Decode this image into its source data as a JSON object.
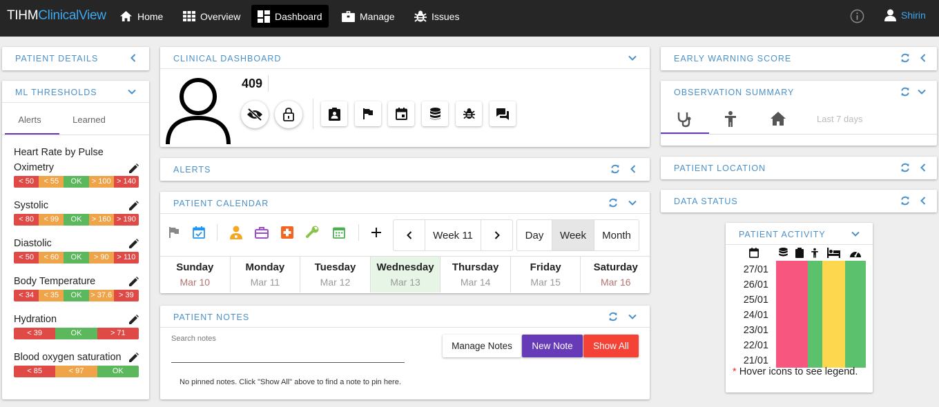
{
  "app": {
    "brand_part1": "TIHM",
    "brand_part2": "ClinicalView"
  },
  "nav": [
    {
      "label": "Home",
      "icon": "home-icon"
    },
    {
      "label": "Overview",
      "icon": "grid-icon"
    },
    {
      "label": "Dashboard",
      "icon": "dashboard-icon",
      "active": true
    },
    {
      "label": "Manage",
      "icon": "briefcase-icon"
    },
    {
      "label": "Issues",
      "icon": "bug-icon"
    }
  ],
  "user": {
    "name": "Shirin"
  },
  "panels": {
    "patient_details": "PATIENT DETAILS",
    "ml_thresholds": "ML THRESHOLDS",
    "clinical_dashboard": "CLINICAL DASHBOARD",
    "alerts": "ALERTS",
    "patient_calendar": "PATIENT CALENDAR",
    "patient_notes": "PATIENT NOTES",
    "early_warning_score": "EARLY WARNING SCORE",
    "observation_summary": "OBSERVATION SUMMARY",
    "patient_location": "PATIENT LOCATION",
    "data_status": "DATA STATUS",
    "patient_activity": "PATIENT ACTIVITY"
  },
  "ml": {
    "tabs": [
      "Alerts",
      "Learned"
    ],
    "thresholds": [
      {
        "name_line1": "Heart Rate by Pulse",
        "name_line2": "Oximetry",
        "segments": [
          {
            "label": "< 50",
            "color": "#e04a46"
          },
          {
            "label": "< 55",
            "color": "#f0a44a"
          },
          {
            "label": "OK",
            "color": "#5cb85c"
          },
          {
            "label": "> 100",
            "color": "#f0a44a"
          },
          {
            "label": "> 140",
            "color": "#e04a46"
          }
        ]
      },
      {
        "name_line1": "Systolic",
        "segments": [
          {
            "label": "< 80",
            "color": "#e04a46"
          },
          {
            "label": "< 99",
            "color": "#f0a44a"
          },
          {
            "label": "OK",
            "color": "#5cb85c"
          },
          {
            "label": "> 160",
            "color": "#f0a44a"
          },
          {
            "label": "> 190",
            "color": "#e04a46"
          }
        ]
      },
      {
        "name_line1": "Diastolic",
        "segments": [
          {
            "label": "< 50",
            "color": "#e04a46"
          },
          {
            "label": "< 60",
            "color": "#f0a44a"
          },
          {
            "label": "OK",
            "color": "#5cb85c"
          },
          {
            "label": "> 90",
            "color": "#f0a44a"
          },
          {
            "label": "> 110",
            "color": "#e04a46"
          }
        ]
      },
      {
        "name_line1": "Body Temperature",
        "segments": [
          {
            "label": "< 34",
            "color": "#e04a46"
          },
          {
            "label": "< 35",
            "color": "#f0a44a"
          },
          {
            "label": "OK",
            "color": "#5cb85c"
          },
          {
            "label": "> 37.6",
            "color": "#f0a44a"
          },
          {
            "label": "> 39",
            "color": "#e04a46"
          }
        ]
      },
      {
        "name_line1": "Hydration",
        "segments": [
          {
            "label": "< 39",
            "color": "#e04a46"
          },
          {
            "label": "OK",
            "color": "#5cb85c"
          },
          {
            "label": "> 71",
            "color": "#e04a46"
          }
        ]
      },
      {
        "name_line1": "Blood oxygen saturation",
        "segments": [
          {
            "label": "< 85",
            "color": "#e04a46"
          },
          {
            "label": "< 97",
            "color": "#f0a44a"
          },
          {
            "label": "OK",
            "color": "#5cb85c"
          }
        ]
      }
    ]
  },
  "patient": {
    "id": "409"
  },
  "calendar": {
    "week_label": "Week 11",
    "views": [
      "Day",
      "Week",
      "Month"
    ],
    "selected_view": "Week",
    "days": [
      {
        "name": "Sunday",
        "date": "Mar 10",
        "weekend": true
      },
      {
        "name": "Monday",
        "date": "Mar 11"
      },
      {
        "name": "Tuesday",
        "date": "Mar 12"
      },
      {
        "name": "Wednesday",
        "date": "Mar 13",
        "today": true
      },
      {
        "name": "Thursday",
        "date": "Mar 14"
      },
      {
        "name": "Friday",
        "date": "Mar 15"
      },
      {
        "name": "Saturday",
        "date": "Mar 16",
        "weekend": true
      }
    ]
  },
  "notes": {
    "search_label": "Search notes",
    "manage_label": "Manage Notes",
    "new_label": "New Note",
    "show_all_label": "Show All",
    "empty_message": "No pinned notes. Click \"Show All\" above to find a note to pin here."
  },
  "observation": {
    "range_label": "Last 7 days"
  },
  "activity": {
    "dates": [
      "27/01",
      "26/01",
      "25/01",
      "24/01",
      "23/01",
      "22/01",
      "21/01"
    ],
    "colors": [
      "#f7577f",
      "#5cc16c",
      "#fdd84e",
      "#5cc16c"
    ],
    "legend_note": "Hover icons to see legend.",
    "legend_marker": "*"
  }
}
